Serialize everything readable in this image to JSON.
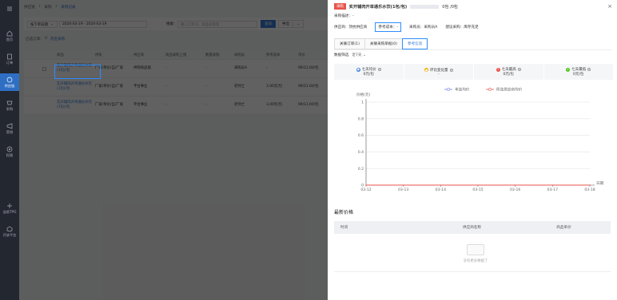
{
  "nav": [
    {
      "label": "首页",
      "icon": "home-icon"
    },
    {
      "label": "订单",
      "icon": "order-icon"
    },
    {
      "label": "供应链",
      "icon": "supply-chain-icon"
    },
    {
      "label": "采购",
      "icon": "purchase-icon"
    },
    {
      "label": "营销",
      "icon": "marketing-icon"
    },
    {
      "label": "权限",
      "icon": "permission-icon"
    },
    {
      "label": "连锁TPO",
      "icon": "chain-icon"
    },
    {
      "label": "开放平台",
      "icon": "open-platform-icon"
    }
  ],
  "breadcrumb": [
    "供应链",
    "采购",
    "采购记录"
  ],
  "filter": {
    "date_type": "按下单日期",
    "date_range": "2020-03-19  -  2020-03-19",
    "search_label": "搜索:",
    "search_placeholder": "输入订单号、商品名称等",
    "search_button": "查询",
    "export_button": "导出"
  },
  "selection": {
    "text": "已选订单:",
    "count": "0",
    "link": "开启采购"
  },
  "table": {
    "headers": [
      "",
      "商品",
      "供货",
      "供应商",
      "商品采购上限",
      "数量采购",
      "采购员",
      "参考成本",
      "单价"
    ],
    "rows": [
      {
        "product": "实开辅肉开单通乐水饮(1包)/包",
        "supply": "厂家/单价/自/厂家",
        "vendor": "供销商品版",
        "limit": "-",
        "qty": "-",
        "buyer": "采购员A",
        "cost": "-",
        "price": "99/11.00/包"
      },
      {
        "product": "实开辅肉开单通乐水饮(1包)/包",
        "supply": "厂家/单价/自/厂家",
        "vendor": "平台事业",
        "limit": "-",
        "qty": "-",
        "buyer": "老师士",
        "cost": "3.00元/包",
        "price": "99/11.00/包"
      },
      {
        "product": "实开辅肉开单通乐水饮(1包)/包",
        "supply": "厂家/单价/自/厂家",
        "vendor": "平台事业",
        "limit": "-",
        "qty": "-",
        "buyer": "老师士",
        "cost": "3.00元/包",
        "price": "99/11.00/包"
      }
    ]
  },
  "drawer": {
    "tag": "采购",
    "title": "实开辅肉开单通乐水饮(1包/包)",
    "stock": "0包 /0包",
    "desc": "采购描述：-",
    "supplier": "供应商：顶抗供应商",
    "ref_cost": "参考成本：-",
    "buyer": "采购员：采购员A",
    "suggest": "建议采购：库存充足",
    "tabs": [
      "关联订单(1)",
      "关联采购单据(0)",
      "参考信息"
    ],
    "filter_label": "数据筛选",
    "filter_value": "近7天",
    "cards": [
      {
        "label": "七天均价",
        "value": "0元/包",
        "color": "#3a7bd5",
        "icon": "average-icon"
      },
      {
        "label": "环比变化量",
        "value": "-",
        "color": "#f0b400",
        "icon": "change-icon"
      },
      {
        "label": "七天最高",
        "value": "0元/包",
        "color": "#e9544b",
        "icon": "highest-icon"
      },
      {
        "label": "七天最低",
        "value": "0元/包",
        "color": "#52c41a",
        "icon": "lowest-icon"
      }
    ],
    "section_title": "最新价格",
    "price_headers": [
      "时间",
      "供应商名称",
      "商品单价"
    ],
    "empty_text": "没有更多数据了"
  },
  "chart_data": {
    "type": "line",
    "ylabel": "价格(元)",
    "xlabel": "日期",
    "categories": [
      "03-12",
      "03-13",
      "03-14",
      "03-15",
      "03-16",
      "03-17",
      "03-18"
    ],
    "ylim": [
      0,
      1
    ],
    "yticks": [
      "0",
      "0.2",
      "0.4",
      "0.6",
      "0.8",
      "1"
    ],
    "series": [
      {
        "name": "本店均价",
        "color": "#7b7fe6",
        "values": [
          0,
          0,
          0,
          0,
          0,
          0,
          0
        ]
      },
      {
        "name": "所选供应商均价",
        "color": "#e9544b",
        "values": [
          0,
          0,
          0,
          0,
          0,
          0,
          0
        ]
      }
    ],
    "legend": "top-center",
    "grid": true
  }
}
